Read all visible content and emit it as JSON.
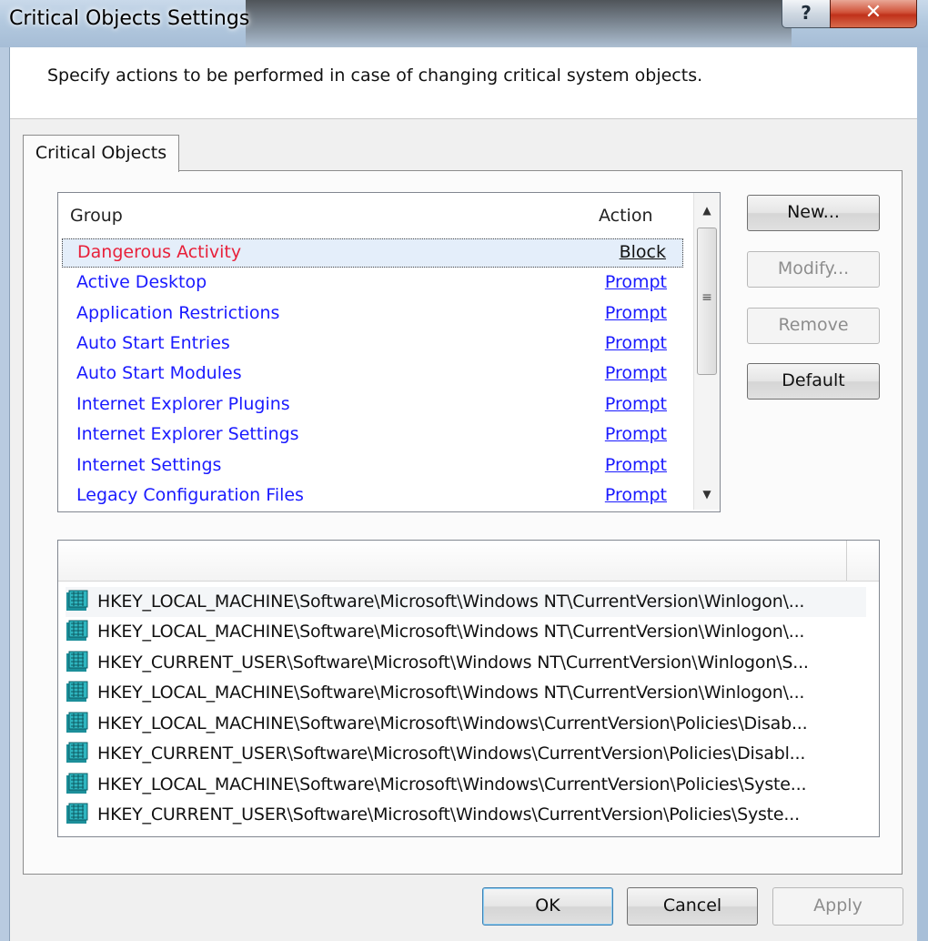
{
  "window": {
    "title": "Critical Objects Settings",
    "help_glyph": "?",
    "close_glyph": "✕"
  },
  "description": "Specify actions to be performed in case of changing critical system objects.",
  "tab": {
    "label": "Critical Objects"
  },
  "groups": {
    "col_group": "Group",
    "col_action": "Action",
    "rows": [
      {
        "group": "Dangerous Activity",
        "action": "Block",
        "selected": true
      },
      {
        "group": "Active Desktop",
        "action": "Prompt"
      },
      {
        "group": "Application Restrictions",
        "action": "Prompt"
      },
      {
        "group": "Auto Start Entries",
        "action": "Prompt"
      },
      {
        "group": "Auto Start Modules",
        "action": "Prompt"
      },
      {
        "group": "Internet Explorer Plugins",
        "action": "Prompt"
      },
      {
        "group": "Internet Explorer Settings",
        "action": "Prompt"
      },
      {
        "group": "Internet Settings",
        "action": "Prompt"
      },
      {
        "group": "Legacy Configuration Files",
        "action": "Prompt"
      }
    ],
    "scroll_up": "▲",
    "scroll_down": "▼",
    "thumb_grip": "≡"
  },
  "side_buttons": {
    "new": "New...",
    "modify": "Modify...",
    "remove": "Remove",
    "default": "Default"
  },
  "registry": [
    "HKEY_LOCAL_MACHINE\\Software\\Microsoft\\Windows NT\\CurrentVersion\\Winlogon\\...",
    "HKEY_LOCAL_MACHINE\\Software\\Microsoft\\Windows NT\\CurrentVersion\\Winlogon\\...",
    "HKEY_CURRENT_USER\\Software\\Microsoft\\Windows NT\\CurrentVersion\\Winlogon\\S...",
    "HKEY_LOCAL_MACHINE\\Software\\Microsoft\\Windows NT\\CurrentVersion\\Winlogon\\...",
    "HKEY_LOCAL_MACHINE\\Software\\Microsoft\\Windows\\CurrentVersion\\Policies\\Disab...",
    "HKEY_CURRENT_USER\\Software\\Microsoft\\Windows\\CurrentVersion\\Policies\\Disabl...",
    "HKEY_LOCAL_MACHINE\\Software\\Microsoft\\Windows\\CurrentVersion\\Policies\\Syste...",
    "HKEY_CURRENT_USER\\Software\\Microsoft\\Windows\\CurrentVersion\\Policies\\Syste..."
  ],
  "bottom_buttons": {
    "ok": "OK",
    "cancel": "Cancel",
    "apply": "Apply"
  },
  "colors": {
    "link": "#1a1aff",
    "selected_group": "#e8203a",
    "close_red": "#c0311a"
  }
}
